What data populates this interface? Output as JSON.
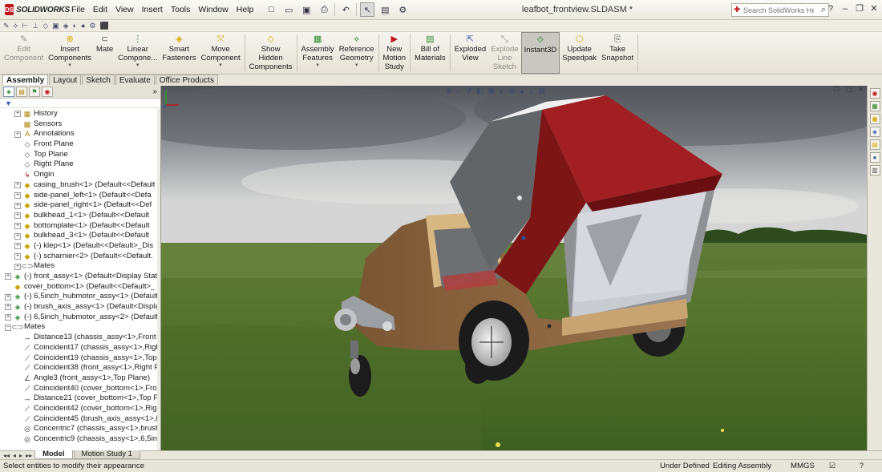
{
  "app": {
    "brand": "SOLIDWORKS",
    "document_title": "leafbot_frontview.SLDASM *"
  },
  "menu": [
    "File",
    "Edit",
    "View",
    "Insert",
    "Tools",
    "Window",
    "Help"
  ],
  "quick_access": [
    {
      "name": "new-icon",
      "glyph": "□"
    },
    {
      "name": "open-icon",
      "glyph": "▭"
    },
    {
      "name": "save-icon",
      "glyph": "▣"
    },
    {
      "name": "print-icon",
      "glyph": "⎙"
    },
    {
      "name": "undo-icon",
      "glyph": "↶"
    },
    {
      "name": "select-icon",
      "glyph": "↖"
    },
    {
      "name": "rebuild-icon",
      "glyph": "▤"
    },
    {
      "name": "options-icon",
      "glyph": "⚙"
    }
  ],
  "help_search": {
    "placeholder": "Search SolidWorks Help"
  },
  "window_controls": [
    {
      "name": "help-dropdown-icon",
      "glyph": "?"
    },
    {
      "name": "minimize-icon",
      "glyph": "–"
    },
    {
      "name": "restore-icon",
      "glyph": "❐"
    },
    {
      "name": "close-icon",
      "glyph": "✕"
    }
  ],
  "command_manager": [
    {
      "name": "edit-component",
      "label": "Edit\nComponent",
      "icon": "✎",
      "color": "#8f8f8f",
      "disabled": true,
      "arrow": false
    },
    {
      "name": "insert-components",
      "label": "Insert\nComponents",
      "icon": "⊕",
      "color": "#d9a800",
      "disabled": false,
      "arrow": true
    },
    {
      "name": "mate",
      "label": "Mate",
      "icon": "⊂",
      "color": "#555555",
      "disabled": false,
      "arrow": false
    },
    {
      "name": "linear-component",
      "label": "Linear\nCompone...",
      "icon": "⋮",
      "color": "#2e8b2e",
      "disabled": false,
      "arrow": true
    },
    {
      "name": "smart-fasteners",
      "label": "Smart\nFasteners",
      "icon": "◈",
      "color": "#d9a800",
      "disabled": false,
      "arrow": false
    },
    {
      "name": "move-component",
      "label": "Move\nComponent",
      "icon": "⤧",
      "color": "#d9a800",
      "disabled": false,
      "arrow": true
    },
    {
      "name": "show-hidden-components",
      "label": "Show\nHidden\nComponents",
      "icon": "◇",
      "color": "#d9a800",
      "disabled": false,
      "arrow": false
    },
    {
      "name": "assembly-features",
      "label": "Assembly\nFeatures",
      "icon": "▦",
      "color": "#2e8b2e",
      "disabled": false,
      "arrow": true
    },
    {
      "name": "reference-geometry",
      "label": "Reference\nGeometry",
      "icon": "⟡",
      "color": "#2e8b2e",
      "disabled": false,
      "arrow": true
    },
    {
      "name": "new-motion-study",
      "label": "New\nMotion\nStudy",
      "icon": "▶",
      "color": "#c0151b",
      "disabled": false,
      "arrow": false
    },
    {
      "name": "bill-of-materials",
      "label": "Bill of\nMaterials",
      "icon": "▤",
      "color": "#2e8b2e",
      "disabled": false,
      "arrow": false
    },
    {
      "name": "exploded-view",
      "label": "Exploded\nView",
      "icon": "⇱",
      "color": "#3b5ba9",
      "disabled": false,
      "arrow": false
    },
    {
      "name": "explode-line-sketch",
      "label": "Explode\nLine\nSketch",
      "icon": "⤡",
      "color": "#8f8f8f",
      "disabled": true,
      "arrow": false
    },
    {
      "name": "instant3d",
      "label": "Instant3D",
      "icon": "⟐",
      "color": "#2e8b2e",
      "disabled": false,
      "arrow": false,
      "active": true
    },
    {
      "name": "update-speedpak",
      "label": "Update\nSpeedpak",
      "icon": "⬡",
      "color": "#d9a800",
      "disabled": false,
      "arrow": false
    },
    {
      "name": "take-snapshot",
      "label": "Take\nSnapshot",
      "icon": "⎘",
      "color": "#555555",
      "disabled": false,
      "arrow": false
    }
  ],
  "command_tabs": [
    {
      "label": "Assembly",
      "active": true
    },
    {
      "label": "Layout",
      "active": false
    },
    {
      "label": "Sketch",
      "active": false
    },
    {
      "label": "Evaluate",
      "active": false
    },
    {
      "label": "Office Products",
      "active": false
    }
  ],
  "tree": [
    {
      "label": "History",
      "indent": 1,
      "exp": "+",
      "icon": "history-icon",
      "glyph": "▦",
      "color": "#b0850f"
    },
    {
      "label": "Sensors",
      "indent": 1,
      "exp": "",
      "icon": "sensors-icon",
      "glyph": "▩",
      "color": "#b0850f"
    },
    {
      "label": "Annotations",
      "indent": 1,
      "exp": "+",
      "icon": "annotations-icon",
      "glyph": "A",
      "color": "#b0850f"
    },
    {
      "label": "Front Plane",
      "indent": 1,
      "exp": "",
      "icon": "plane-icon",
      "glyph": "◇",
      "color": "#555"
    },
    {
      "label": "Top Plane",
      "indent": 1,
      "exp": "",
      "icon": "plane-icon",
      "glyph": "◇",
      "color": "#555"
    },
    {
      "label": "Right Plane",
      "indent": 1,
      "exp": "",
      "icon": "plane-icon",
      "glyph": "◇",
      "color": "#555"
    },
    {
      "label": "Origin",
      "indent": 1,
      "exp": "",
      "icon": "origin-icon",
      "glyph": "↳",
      "color": "#a01010"
    },
    {
      "label": "casing_brush<1> (Default<<Default",
      "indent": 1,
      "exp": "+",
      "icon": "part-icon",
      "glyph": "◆",
      "color": "#c9a400"
    },
    {
      "label": "side-panel_left<1> (Default<<Defa",
      "indent": 1,
      "exp": "+",
      "icon": "part-icon",
      "glyph": "◆",
      "color": "#c9a400"
    },
    {
      "label": "side-panel_right<1> (Default<<Def",
      "indent": 1,
      "exp": "+",
      "icon": "part-icon",
      "glyph": "◆",
      "color": "#c9a400"
    },
    {
      "label": "bulkhead_1<1> (Default<<Default",
      "indent": 1,
      "exp": "+",
      "icon": "part-icon",
      "glyph": "◆",
      "color": "#c9a400"
    },
    {
      "label": "bottomplate<1> (Default<<Default",
      "indent": 1,
      "exp": "+",
      "icon": "part-icon",
      "glyph": "◆",
      "color": "#c9a400"
    },
    {
      "label": "bulkhead_3<1> (Default<<Default",
      "indent": 1,
      "exp": "+",
      "icon": "part-icon",
      "glyph": "◆",
      "color": "#c9a400"
    },
    {
      "label": "(-) klep<1> (Default<<Default>_Dis",
      "indent": 1,
      "exp": "+",
      "icon": "part-icon",
      "glyph": "◆",
      "color": "#c9a400"
    },
    {
      "label": "(-) scharnier<2> (Default<<Default.",
      "indent": 1,
      "exp": "+",
      "icon": "part-icon",
      "glyph": "◆",
      "color": "#c9a400"
    },
    {
      "label": "Mates",
      "indent": 1,
      "exp": "+",
      "icon": "mates-icon",
      "glyph": "⊂⊃",
      "color": "#555"
    },
    {
      "label": "(-) front_assy<1> (Default<Display Stat",
      "indent": 0,
      "exp": "+",
      "icon": "assembly-icon",
      "glyph": "◈",
      "color": "#2e8b2e"
    },
    {
      "label": "cover_bottom<1> (Default<<Default>_",
      "indent": 0,
      "exp": "",
      "icon": "part-icon",
      "glyph": "◆",
      "color": "#c9a400"
    },
    {
      "label": "(-) 6,5inch_hubmotor_assy<1> (Default",
      "indent": 0,
      "exp": "+",
      "icon": "assembly-icon",
      "glyph": "◈",
      "color": "#2e8b2e"
    },
    {
      "label": "(-) brush_axis_assy<1> (Default<Displa",
      "indent": 0,
      "exp": "+",
      "icon": "assembly-icon",
      "glyph": "◈",
      "color": "#2e8b2e"
    },
    {
      "label": "(-) 6,5inch_hubmotor_assy<2> (Default",
      "indent": 0,
      "exp": "+",
      "icon": "assembly-icon",
      "glyph": "◈",
      "color": "#2e8b2e"
    },
    {
      "label": "Mates",
      "indent": 0,
      "exp": "−",
      "icon": "mates-icon",
      "glyph": "⊂⊃",
      "color": "#555"
    },
    {
      "label": "Distance13 (chassis_assy<1>,Front Plan",
      "indent": 1,
      "exp": "",
      "icon": "distance-mate-icon",
      "glyph": "↔",
      "color": "#333"
    },
    {
      "label": "Coincident17 (chassis_assy<1>,Right Pl",
      "indent": 1,
      "exp": "",
      "icon": "coincident-mate-icon",
      "glyph": "⟋",
      "color": "#333"
    },
    {
      "label": "Coincident19 (chassis_assy<1>,Top Pla",
      "indent": 1,
      "exp": "",
      "icon": "coincident-mate-icon",
      "glyph": "⟋",
      "color": "#333"
    },
    {
      "label": "Coincident38 (front_assy<1>,Right Pla",
      "indent": 1,
      "exp": "",
      "icon": "coincident-mate-icon",
      "glyph": "⟋",
      "color": "#333"
    },
    {
      "label": "Angle3 (front_assy<1>,Top Plane)",
      "indent": 1,
      "exp": "",
      "icon": "angle-mate-icon",
      "glyph": "∠",
      "color": "#333"
    },
    {
      "label": "Coincident40 (cover_bottom<1>,Front",
      "indent": 1,
      "exp": "",
      "icon": "coincident-mate-icon",
      "glyph": "⟋",
      "color": "#333"
    },
    {
      "label": "Distance21 (cover_bottom<1>,Top Pla",
      "indent": 1,
      "exp": "",
      "icon": "distance-mate-icon",
      "glyph": "↔",
      "color": "#333"
    },
    {
      "label": "Coincident42 (cover_bottom<1>,Right",
      "indent": 1,
      "exp": "",
      "icon": "coincident-mate-icon",
      "glyph": "⟋",
      "color": "#333"
    },
    {
      "label": "Coincident45 (brush_axis_assy<1>,Righ",
      "indent": 1,
      "exp": "",
      "icon": "coincident-mate-icon",
      "glyph": "⟋",
      "color": "#333"
    },
    {
      "label": "Concentric7 (chassis_assy<1>,brush_ax",
      "indent": 1,
      "exp": "",
      "icon": "concentric-mate-icon",
      "glyph": "◎",
      "color": "#333"
    },
    {
      "label": "Concentric9 (chassis_assy<1>,6,5inch_h",
      "indent": 1,
      "exp": "",
      "icon": "concentric-mate-icon",
      "glyph": "◎",
      "color": "#333"
    }
  ],
  "bottom_tabs": [
    {
      "label": "Model",
      "active": true
    },
    {
      "label": "Motion Study 1",
      "active": false
    }
  ],
  "status": {
    "message": "Select entities to modify their appearance",
    "state": "Under Defined",
    "mode": "Editing Assembly",
    "units": "MMGS"
  }
}
